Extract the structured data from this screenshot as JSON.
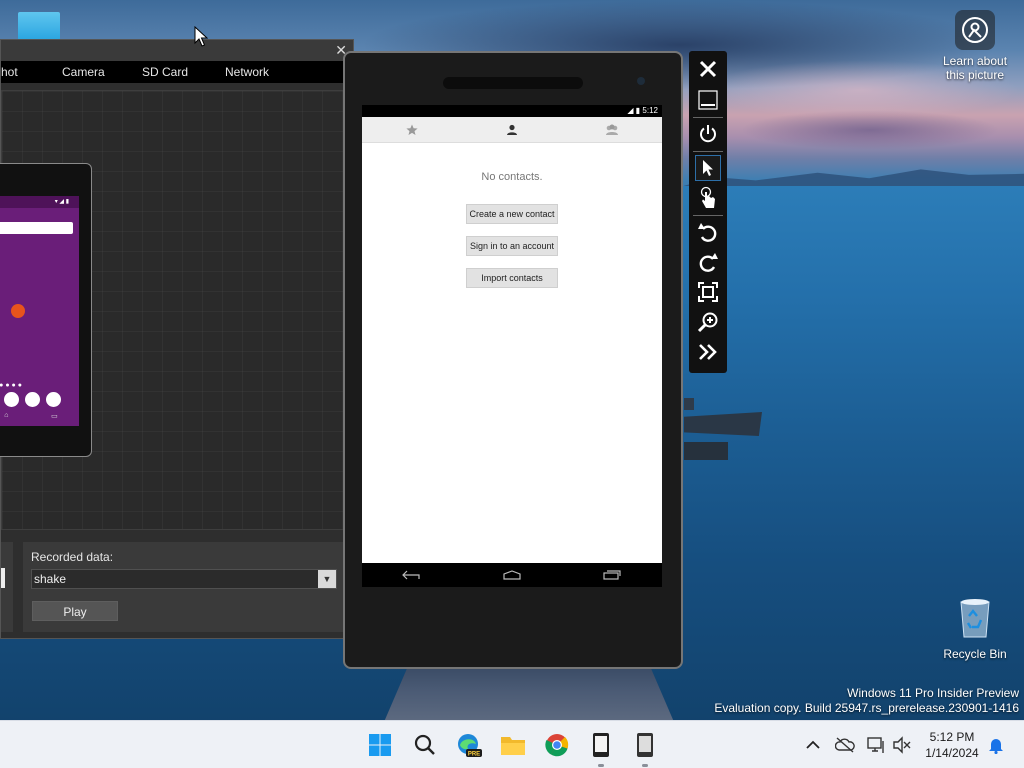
{
  "desktop": {
    "learn_text": "Learn about this picture",
    "recycle_label": "Recycle Bin",
    "watermark_line1": "Windows 11 Pro Insider Preview",
    "watermark_line2": "Evaluation copy. Build 25947.rs_prerelease.230901-1416"
  },
  "tools_window": {
    "close_glyph": "✕",
    "tabs": [
      "hot",
      "Camera",
      "SD Card",
      "Network"
    ],
    "recorded_label": "Recorded data:",
    "recorded_value": "shake",
    "play_label": "Play"
  },
  "emulator": {
    "status_time": "5:12",
    "no_contacts": "No contacts.",
    "buttons": [
      "Create a new contact",
      "Sign in to an account",
      "Import contacts"
    ]
  },
  "toolbar": {
    "icons": [
      "close-icon",
      "minimize-icon",
      "power-icon",
      "pointer-icon",
      "touch-icon",
      "rotate-left-icon",
      "rotate-right-icon",
      "fit-screen-icon",
      "zoom-icon",
      "more-icon"
    ]
  },
  "taskbar": {
    "time": "5:12 PM",
    "date": "1/14/2024",
    "edge_badge": "PRE"
  },
  "colors": {
    "accent": "#33b5e5",
    "emulator_frame": "#1b1b1b",
    "tools_bg": "#2e2e2e",
    "launcher_purple": "#6a1e79"
  }
}
